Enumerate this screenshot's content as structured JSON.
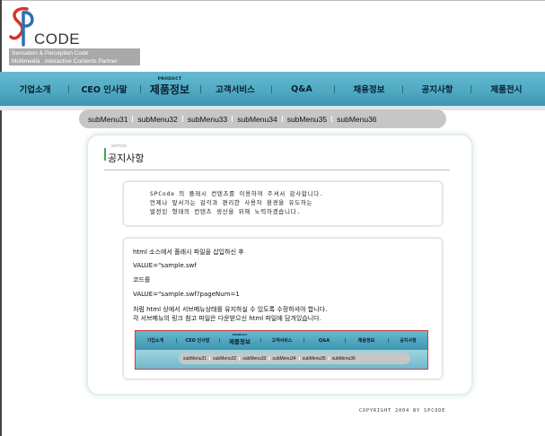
{
  "logo": {
    "word": "CODE",
    "tagline_1": "Sensation & Perception Code",
    "tagline_2": "Multimedia . Interactive Contents Partner"
  },
  "nav": {
    "items": [
      {
        "label": "기업소개"
      },
      {
        "label": "CEO 인사말"
      },
      {
        "label": "제품정보",
        "sup": "PRODUCT",
        "active": true
      },
      {
        "label": "고객서비스"
      },
      {
        "label": "Q&A"
      },
      {
        "label": "채용정보"
      },
      {
        "label": "공지사항"
      },
      {
        "label": "제품전시"
      }
    ]
  },
  "submenu": {
    "items": [
      "subMenu31",
      "subMenu32",
      "subMenu33",
      "subMenu34",
      "subMenu35",
      "subMenu36"
    ]
  },
  "notice": {
    "small_label": "NOTICE",
    "title": "공지사항"
  },
  "intro": {
    "line1": "SPCode 의 플래시 컨텐츠를 이용하여 주셔서 감사합니다.",
    "line2": "언제나 앞서가는 감각과 편리한 사용자 환경을  유도하는",
    "line3": "발전된 형태의 컨텐츠 생산을 위해 노력하겠습니다."
  },
  "instructions": {
    "line1": "html 소스에서 플래시 파일을 삽입하신 후",
    "line2": "VALUE=\"sample.swf",
    "line3": "코드를",
    "line4": "VALUE=\"sample.swf?pageNum=1",
    "line5": "처럼 html 상에서 서브메뉴상태를 유지하실 수  있도록 수정하셔야 합니다.",
    "line6": "각 서브메뉴의 링크 참고 파일은 다운받으신 html 파일에 담겨있습니다."
  },
  "preview": {
    "nav_items": [
      {
        "label": "기업소개"
      },
      {
        "label": "CEO 인사말"
      },
      {
        "label": "제품정보",
        "sup": "PRODUCT",
        "active": true
      },
      {
        "label": "고객서비스"
      },
      {
        "label": "Q&A"
      },
      {
        "label": "채용정보"
      },
      {
        "label": "공지사항"
      }
    ],
    "sub_items": [
      "subMenu31",
      "subMenu32",
      "subMenu33",
      "subMenu34",
      "subMenu35",
      "subMenu36"
    ]
  },
  "footer": {
    "copyright": "COPYRIGHT 2004 BY SPCODE"
  },
  "colors": {
    "nav_blue": "#4ea8c1",
    "submenu_gray": "#c6c6c6",
    "logo_red": "#d6322f",
    "logo_blue": "#2f6fb0",
    "accent_green": "#46a946",
    "preview_border": "#d23a3a"
  }
}
